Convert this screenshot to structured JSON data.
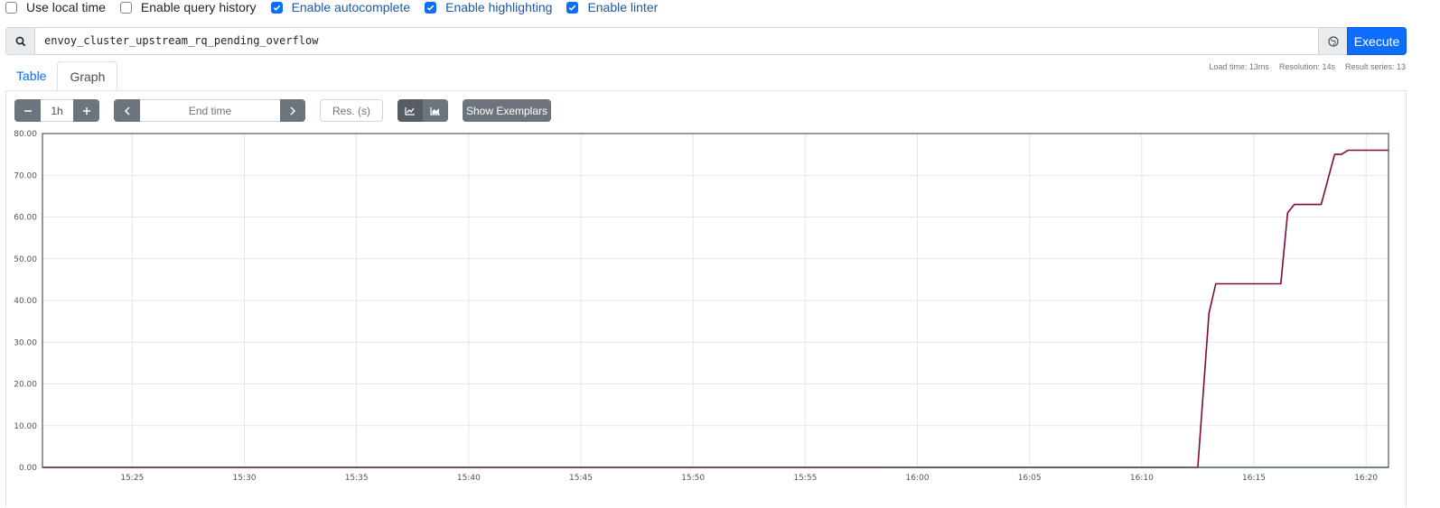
{
  "options": [
    {
      "label": "Use local time",
      "checked": false
    },
    {
      "label": "Enable query history",
      "checked": false
    },
    {
      "label": "Enable autocomplete",
      "checked": true
    },
    {
      "label": "Enable highlighting",
      "checked": true
    },
    {
      "label": "Enable linter",
      "checked": true
    }
  ],
  "query": {
    "expression": "envoy_cluster_upstream_rq_pending_overflow",
    "execute_label": "Execute",
    "search_icon": "search-icon",
    "metrics_icon": "globe-icon"
  },
  "tabs": [
    {
      "label": "Table",
      "active": false
    },
    {
      "label": "Graph",
      "active": true
    }
  ],
  "stats": {
    "load_time": "Load time: 13ms",
    "resolution": "Resolution: 14s",
    "result_series": "Result series: 13"
  },
  "controls": {
    "minus_icon": "minus-icon",
    "range_value": "1h",
    "plus_icon": "plus-icon",
    "prev_icon": "chevron-left-icon",
    "end_time_placeholder": "End time",
    "next_icon": "chevron-right-icon",
    "resolution_placeholder": "Res. (s)",
    "unstacked_icon": "line-chart-icon",
    "stacked_icon": "area-chart-icon",
    "show_exemplars_label": "Show Exemplars"
  },
  "colors": {
    "accent": "#0d6efd",
    "series_main": "#7b0a3f",
    "series_purple": "#6e1ea8",
    "series_green": "#4f8a32",
    "series_blue": "#4a8fd6"
  },
  "chart_data": {
    "type": "line",
    "ylim": [
      0,
      80
    ],
    "yticks": [
      "0.00",
      "10.00",
      "20.00",
      "30.00",
      "40.00",
      "50.00",
      "60.00",
      "70.00",
      "80.00"
    ],
    "xlim": [
      "15:21",
      "16:21"
    ],
    "xticks": [
      "15:25",
      "15:30",
      "15:35",
      "15:40",
      "15:45",
      "15:50",
      "15:55",
      "16:00",
      "16:05",
      "16:10",
      "16:15",
      "16:20"
    ],
    "grid": true,
    "series": [
      {
        "color": "#6e1ea8",
        "points": [
          [
            "15:21",
            0
          ],
          [
            "15:58.3",
            0
          ]
        ]
      },
      {
        "color": "#4f8a32",
        "points": [
          [
            "15:58.3",
            0
          ],
          [
            "16:12",
            0
          ]
        ]
      },
      {
        "color": "#4a8fd6",
        "points": [
          [
            "16:12",
            0
          ],
          [
            "16:21",
            0
          ]
        ]
      },
      {
        "color": "#7b0a3f",
        "points": [
          [
            "15:21",
            0
          ],
          [
            "16:12.5",
            0
          ],
          [
            "16:13",
            37
          ],
          [
            "16:13.3",
            44
          ],
          [
            "16:16",
            44
          ],
          [
            "16:16.2",
            44
          ],
          [
            "16:16.5",
            61
          ],
          [
            "16:16.8",
            63
          ],
          [
            "16:18",
            63
          ],
          [
            "16:18.6",
            75
          ],
          [
            "16:18.9",
            75
          ],
          [
            "16:19.2",
            76
          ],
          [
            "16:21",
            76
          ]
        ]
      }
    ]
  }
}
